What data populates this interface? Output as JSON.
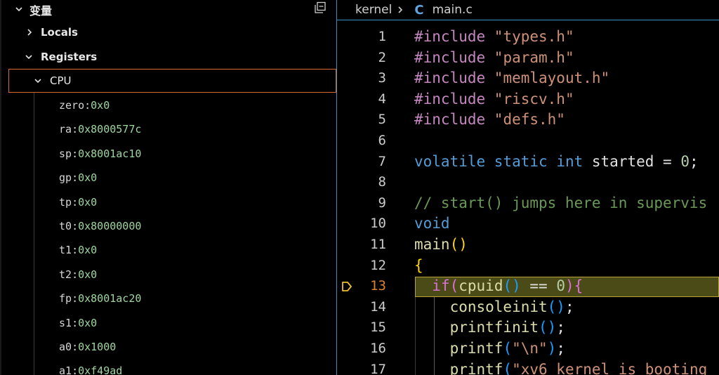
{
  "variables_panel": {
    "title": "变量",
    "collapse_all_label": "⧉",
    "locals_label": "Locals",
    "registers_label": "Registers",
    "cpu_label": "CPU",
    "registers": [
      {
        "name": "zero",
        "value": "0x0"
      },
      {
        "name": "ra",
        "value": "0x8000577c"
      },
      {
        "name": "sp",
        "value": "0x8001ac10"
      },
      {
        "name": "gp",
        "value": "0x0"
      },
      {
        "name": "tp",
        "value": "0x0"
      },
      {
        "name": "t0",
        "value": "0x80000000"
      },
      {
        "name": "t1",
        "value": "0x0"
      },
      {
        "name": "t2",
        "value": "0x0"
      },
      {
        "name": "fp",
        "value": "0x8001ac20"
      },
      {
        "name": "s1",
        "value": "0x0"
      },
      {
        "name": "a0",
        "value": "0x1000"
      },
      {
        "name": "a1",
        "value": "0xf49ad"
      }
    ]
  },
  "editor": {
    "breadcrumb": {
      "folder": "kernel",
      "file_icon": "C",
      "file": "main.c"
    },
    "current_line": 13,
    "lines": [
      {
        "n": "1",
        "tokens": [
          [
            "kw-inc",
            "#include "
          ],
          [
            "str",
            "\"types.h\""
          ]
        ]
      },
      {
        "n": "2",
        "tokens": [
          [
            "kw-inc",
            "#include "
          ],
          [
            "str",
            "\"param.h\""
          ]
        ]
      },
      {
        "n": "3",
        "tokens": [
          [
            "kw-inc",
            "#include "
          ],
          [
            "str",
            "\"memlayout.h\""
          ]
        ]
      },
      {
        "n": "4",
        "tokens": [
          [
            "kw-inc",
            "#include "
          ],
          [
            "str",
            "\"riscv.h\""
          ]
        ]
      },
      {
        "n": "5",
        "tokens": [
          [
            "kw-inc",
            "#include "
          ],
          [
            "str",
            "\"defs.h\""
          ]
        ]
      },
      {
        "n": "6",
        "tokens": []
      },
      {
        "n": "7",
        "tokens": [
          [
            "kw",
            "volatile "
          ],
          [
            "kw",
            "static "
          ],
          [
            "kw",
            "int "
          ],
          [
            "idn",
            "started "
          ],
          [
            "idn",
            "= "
          ],
          [
            "num",
            "0"
          ],
          [
            "idn",
            ";"
          ]
        ]
      },
      {
        "n": "8",
        "tokens": []
      },
      {
        "n": "9",
        "tokens": [
          [
            "cmt",
            "// start() jumps here in supervis"
          ]
        ]
      },
      {
        "n": "10",
        "tokens": [
          [
            "kw",
            "void"
          ]
        ]
      },
      {
        "n": "11",
        "tokens": [
          [
            "fn",
            "main"
          ],
          [
            "par",
            "()"
          ]
        ]
      },
      {
        "n": "12",
        "tokens": [
          [
            "par",
            "{"
          ]
        ]
      },
      {
        "n": "13",
        "tokens": [
          [
            "idn",
            "  "
          ],
          [
            "par2",
            "if"
          ],
          [
            "par2",
            "("
          ],
          [
            "fn",
            "cpuid"
          ],
          [
            "par3",
            "()"
          ],
          [
            "idn",
            " == "
          ],
          [
            "num",
            "0"
          ],
          [
            "par2",
            ")"
          ],
          [
            "par2",
            "{"
          ]
        ]
      },
      {
        "n": "14",
        "tokens": [
          [
            "idn",
            "    "
          ],
          [
            "fn",
            "consoleinit"
          ],
          [
            "par3",
            "()"
          ],
          [
            "idn",
            ";"
          ]
        ]
      },
      {
        "n": "15",
        "tokens": [
          [
            "idn",
            "    "
          ],
          [
            "fn",
            "printfinit"
          ],
          [
            "par3",
            "()"
          ],
          [
            "idn",
            ";"
          ]
        ]
      },
      {
        "n": "16",
        "tokens": [
          [
            "idn",
            "    "
          ],
          [
            "fn",
            "printf"
          ],
          [
            "par3",
            "("
          ],
          [
            "str",
            "\"\\n\""
          ],
          [
            "par3",
            ")"
          ],
          [
            "idn",
            ";"
          ]
        ]
      },
      {
        "n": "17",
        "tokens": [
          [
            "idn",
            "    "
          ],
          [
            "fn",
            "printf"
          ],
          [
            "par3",
            "("
          ],
          [
            "str",
            "\"xv6 kernel is booting"
          ]
        ]
      }
    ]
  }
}
